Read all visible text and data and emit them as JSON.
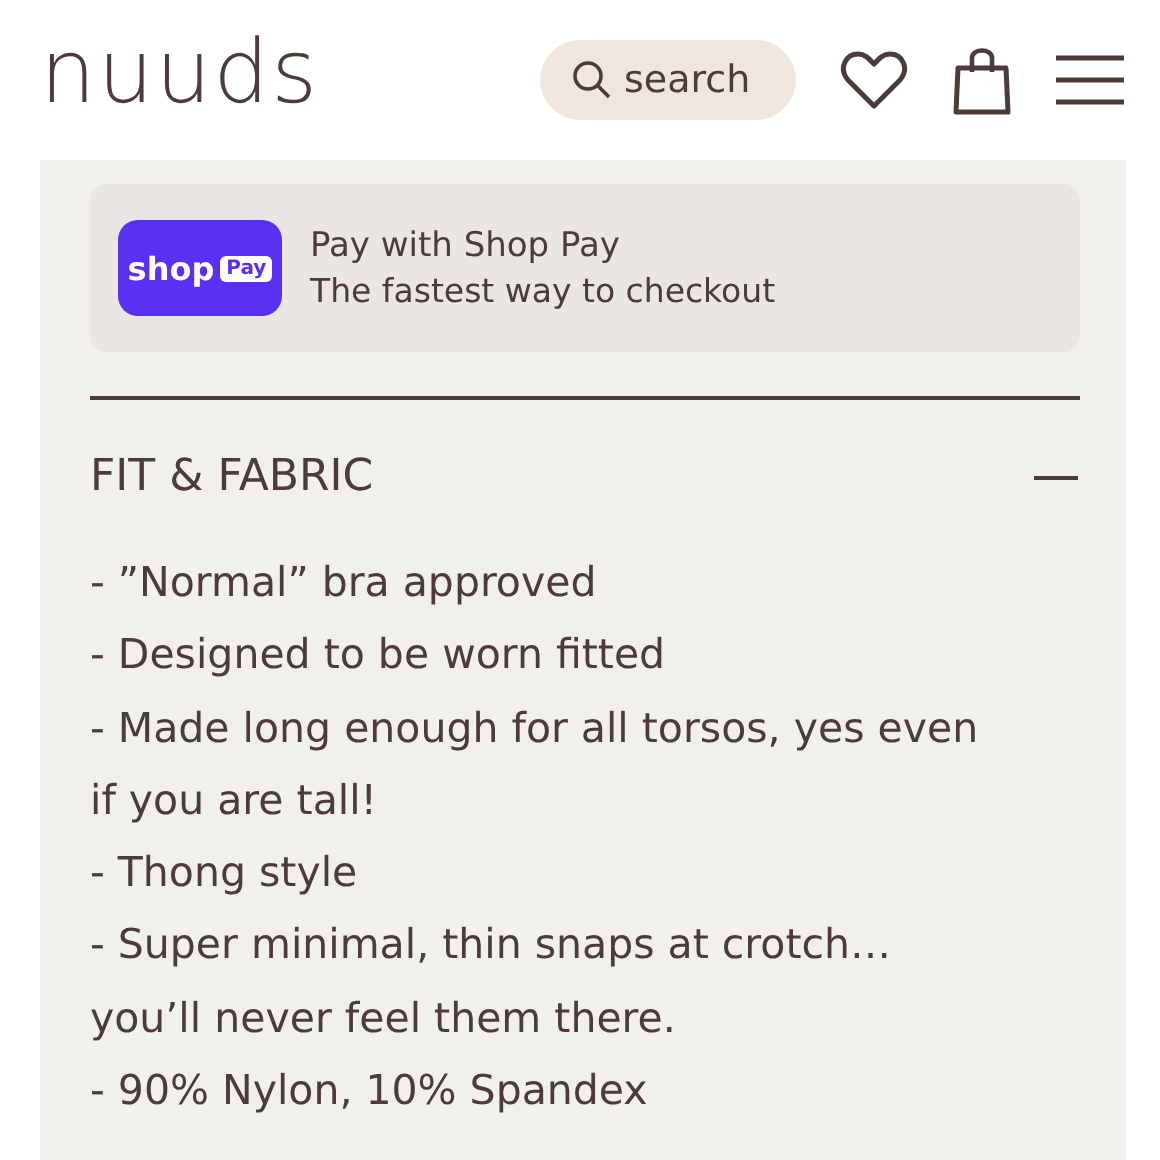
{
  "header": {
    "logo": "nuuds",
    "search": {
      "placeholder": "search"
    }
  },
  "shop_pay": {
    "badge_left": "shop",
    "badge_right": "Pay",
    "title": "Pay with Shop Pay",
    "subtitle": "The fastest way to checkout"
  },
  "section": {
    "title": "FIT & FABRIC",
    "expanded": true,
    "lines": [
      "- ”Normal” bra approved",
      "- Designed to be worn fitted",
      "- Made long enough for all torsos, yes even if you are tall!",
      "- Thong style",
      "- Super minimal, thin snaps at crotch… you’ll never feel them there.",
      "- 90% Nylon, 10% Spandex"
    ]
  }
}
